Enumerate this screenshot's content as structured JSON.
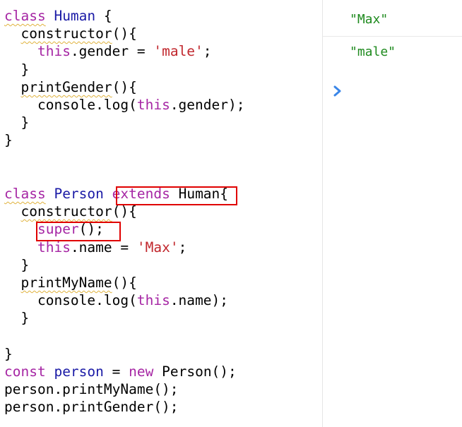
{
  "editor": {
    "lines": [
      {
        "segments": [
          {
            "t": "class",
            "c": "kw",
            "sq": true
          },
          {
            "t": " "
          },
          {
            "t": "Human",
            "c": "kw2"
          },
          {
            "t": " {"
          }
        ]
      },
      {
        "segments": [
          {
            "t": "  "
          },
          {
            "t": "constructor",
            "sq": true
          },
          {
            "t": "(){"
          }
        ]
      },
      {
        "segments": [
          {
            "t": "    "
          },
          {
            "t": "this",
            "c": "kw"
          },
          {
            "t": ".gender = "
          },
          {
            "t": "'male'",
            "c": "str"
          },
          {
            "t": ";"
          }
        ]
      },
      {
        "segments": [
          {
            "t": "  }"
          }
        ]
      },
      {
        "segments": [
          {
            "t": "  "
          },
          {
            "t": "printGender",
            "sq": true
          },
          {
            "t": "(){"
          }
        ]
      },
      {
        "segments": [
          {
            "t": "    console.log("
          },
          {
            "t": "this",
            "c": "kw"
          },
          {
            "t": ".gender);"
          }
        ]
      },
      {
        "segments": [
          {
            "t": "  }"
          }
        ]
      },
      {
        "segments": [
          {
            "t": "}"
          }
        ]
      },
      {
        "segments": []
      },
      {
        "segments": []
      },
      {
        "segments": [
          {
            "t": "class",
            "c": "kw",
            "sq": true
          },
          {
            "t": " "
          },
          {
            "t": "Person",
            "c": "kw2"
          },
          {
            "t": " "
          },
          {
            "t": "extends",
            "c": "kw"
          },
          {
            "t": " Human{"
          }
        ]
      },
      {
        "segments": [
          {
            "t": "  "
          },
          {
            "t": "constructor",
            "sq": true
          },
          {
            "t": "(){"
          }
        ]
      },
      {
        "segments": [
          {
            "t": "    "
          },
          {
            "t": "super",
            "c": "kw"
          },
          {
            "t": "();"
          }
        ]
      },
      {
        "segments": [
          {
            "t": "    "
          },
          {
            "t": "this",
            "c": "kw"
          },
          {
            "t": ".name = "
          },
          {
            "t": "'Max'",
            "c": "str"
          },
          {
            "t": ";"
          }
        ]
      },
      {
        "segments": [
          {
            "t": "  }"
          }
        ]
      },
      {
        "segments": [
          {
            "t": "  "
          },
          {
            "t": "printMyName",
            "sq": true
          },
          {
            "t": "(){"
          }
        ]
      },
      {
        "segments": [
          {
            "t": "    console.log("
          },
          {
            "t": "this",
            "c": "kw"
          },
          {
            "t": ".name);"
          }
        ]
      },
      {
        "segments": [
          {
            "t": "  }"
          }
        ]
      },
      {
        "segments": []
      },
      {
        "segments": [
          {
            "t": "}"
          }
        ]
      },
      {
        "segments": [
          {
            "t": "const",
            "c": "kw"
          },
          {
            "t": " "
          },
          {
            "t": "person",
            "c": "kw2"
          },
          {
            "t": " = "
          },
          {
            "t": "new",
            "c": "kw"
          },
          {
            "t": " Person();"
          }
        ]
      },
      {
        "segments": [
          {
            "t": "person.printMyName();"
          }
        ]
      },
      {
        "segments": [
          {
            "t": "person.printGender();"
          }
        ]
      }
    ]
  },
  "console": {
    "outputs": [
      "\"Max\"",
      "\"male\""
    ],
    "prompt_icon": "chevron-right-icon"
  },
  "colors": {
    "keyword": "#a626a4",
    "identifier": "#1a1aa6",
    "string": "#c1272d",
    "console_string": "#1e8a1e",
    "highlight_box": "#e00000"
  }
}
